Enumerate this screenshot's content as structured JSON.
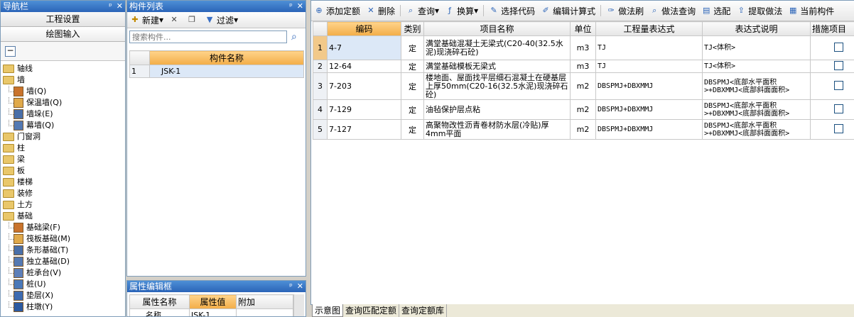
{
  "nav": {
    "title": "导航栏",
    "buttons": [
      "工程设置",
      "绘图输入"
    ],
    "tree": [
      {
        "label": "轴线",
        "kind": "folder",
        "level": 0
      },
      {
        "label": "墙",
        "kind": "folder",
        "level": 0
      },
      {
        "label": "墙(Q)",
        "kind": "leaf",
        "level": 1
      },
      {
        "label": "保温墙(Q)",
        "kind": "leaf",
        "level": 1
      },
      {
        "label": "墙垛(E)",
        "kind": "leaf",
        "level": 1
      },
      {
        "label": "幕墙(Q)",
        "kind": "leaf",
        "level": 1
      },
      {
        "label": "门窗洞",
        "kind": "folder",
        "level": 0
      },
      {
        "label": "柱",
        "kind": "folder",
        "level": 0
      },
      {
        "label": "梁",
        "kind": "folder",
        "level": 0
      },
      {
        "label": "板",
        "kind": "folder",
        "level": 0
      },
      {
        "label": "楼梯",
        "kind": "folder",
        "level": 0
      },
      {
        "label": "装修",
        "kind": "folder",
        "level": 0
      },
      {
        "label": "土方",
        "kind": "folder",
        "level": 0
      },
      {
        "label": "基础",
        "kind": "folder",
        "level": 0
      },
      {
        "label": "基础梁(F)",
        "kind": "leaf",
        "level": 1
      },
      {
        "label": "筏板基础(M)",
        "kind": "leaf",
        "level": 1
      },
      {
        "label": "条形基础(T)",
        "kind": "leaf",
        "level": 1
      },
      {
        "label": "独立基础(D)",
        "kind": "leaf",
        "level": 1
      },
      {
        "label": "桩承台(V)",
        "kind": "leaf",
        "level": 1
      },
      {
        "label": "桩(U)",
        "kind": "leaf",
        "level": 1
      },
      {
        "label": "垫层(X)",
        "kind": "leaf",
        "level": 1
      },
      {
        "label": "柱墩(Y)",
        "kind": "leaf",
        "level": 1
      }
    ]
  },
  "component_list": {
    "title": "构件列表",
    "new_label": "新建",
    "filter_label": "过滤",
    "search_placeholder": "搜索构件...",
    "column": "构件名称",
    "rows": [
      {
        "index": "1",
        "name": "JSK-1"
      }
    ]
  },
  "property_editor": {
    "title": "属性编辑框",
    "columns": [
      "属性名称",
      "属性值",
      "附加"
    ],
    "rows": [
      {
        "name": "名称",
        "value": "JSK-1"
      }
    ]
  },
  "main_toolbar": [
    {
      "label": "添加定额",
      "icon": "add-quota-icon"
    },
    {
      "label": "删除",
      "icon": "delete-icon"
    },
    {
      "label": "查询",
      "icon": "search-icon"
    },
    {
      "label": "换算",
      "icon": "fx-icon"
    },
    {
      "label": "选择代码",
      "icon": "select-code-icon"
    },
    {
      "label": "编辑计算式",
      "icon": "edit-formula-icon"
    },
    {
      "label": "做法刷",
      "icon": "brush-icon"
    },
    {
      "label": "做法查询",
      "icon": "method-query-icon"
    },
    {
      "label": "选配",
      "icon": "config-icon"
    },
    {
      "label": "提取做法",
      "icon": "extract-icon"
    },
    {
      "label": "当前构件",
      "icon": "current-component-icon"
    }
  ],
  "quota_table": {
    "columns": [
      "编码",
      "类别",
      "项目名称",
      "单位",
      "工程量表达式",
      "表达式说明",
      "措施项目"
    ],
    "rows": [
      {
        "no": "1",
        "code": "4-7",
        "type": "定",
        "name": "满堂基础混凝土无梁式(C20-40(32.5水泥)现浇碎石砼)",
        "unit": "m3",
        "expr": "TJ",
        "desc": "TJ<体积>"
      },
      {
        "no": "2",
        "code": "12-64",
        "type": "定",
        "name": "满堂基础模板无梁式",
        "unit": "m3",
        "expr": "TJ",
        "desc": "TJ<体积>"
      },
      {
        "no": "3",
        "code": "7-203",
        "type": "定",
        "name": "楼地面、屋面找平层细石混凝土在硬基层上厚50mm(C20-16(32.5水泥)现浇碎石砼)",
        "unit": "m2",
        "expr": "DBSPMJ+DBXMMJ",
        "desc": "DBSPMJ<底部水平面积>+DBXMMJ<底部斜面面积>"
      },
      {
        "no": "4",
        "code": "7-129",
        "type": "定",
        "name": "油毡保护层点粘",
        "unit": "m2",
        "expr": "DBSPMJ+DBXMMJ",
        "desc": "DBSPMJ<底部水平面积>+DBXMMJ<底部斜面面积>"
      },
      {
        "no": "5",
        "code": "7-127",
        "type": "定",
        "name": "高聚物改性沥青卷材防水层(冷贴)厚4mm平面",
        "unit": "m2",
        "expr": "DBSPMJ+DBXMMJ",
        "desc": "DBSPMJ<底部水平面积>+DBXMMJ<底部斜面面积>"
      }
    ]
  },
  "bottom_tabs": [
    "示意图",
    "查询匹配定额",
    "查询定额库"
  ]
}
